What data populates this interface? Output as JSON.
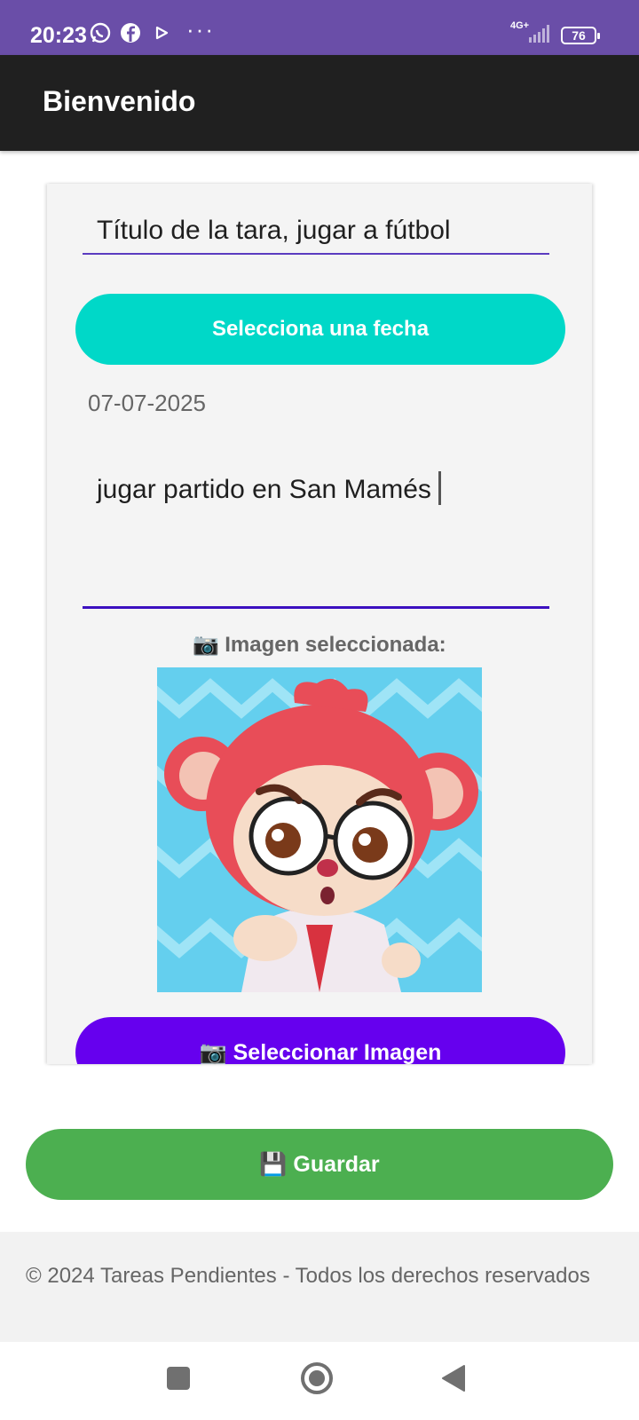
{
  "status_bar": {
    "time": "20:23",
    "network": "4G+",
    "battery": "76"
  },
  "app_bar": {
    "title": "Bienvenido"
  },
  "form": {
    "title_value": "Título de la tara, jugar a fútbol",
    "date_button_label": "Selecciona una fecha",
    "date_value": "07-07-2025",
    "description_value": "jugar partido en San Mamés",
    "image_label": "Imagen seleccionada:",
    "image_label_icon": "📷",
    "select_image_label": "Seleccionar Imagen",
    "select_image_icon": "📷"
  },
  "save": {
    "icon": "💾",
    "label": "Guardar"
  },
  "footer": {
    "text": "© 2024 Tareas Pendientes - Todos los derechos reservados"
  },
  "colors": {
    "status_bar": "#6a4ea8",
    "app_bar": "#202020",
    "date_button": "#00d8c8",
    "image_button": "#6600ee",
    "save_button": "#4caf50",
    "field_underline": "#3c10c0"
  }
}
